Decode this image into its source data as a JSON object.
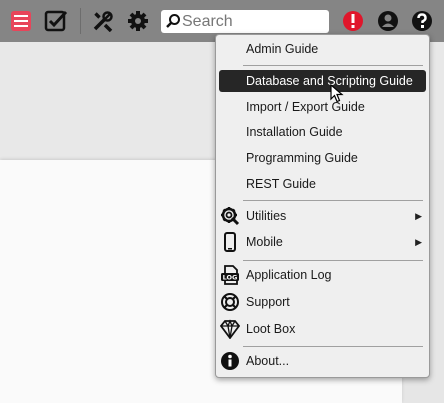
{
  "search": {
    "placeholder": "Search",
    "value": ""
  },
  "menu": {
    "items": [
      {
        "label": "Admin Guide"
      },
      {
        "label": "Database and Scripting Guide"
      },
      {
        "label": "Import / Export Guide"
      },
      {
        "label": "Installation Guide"
      },
      {
        "label": "Programming Guide"
      },
      {
        "label": "REST Guide"
      },
      {
        "label": "Utilities"
      },
      {
        "label": "Mobile"
      },
      {
        "label": "Application Log"
      },
      {
        "label": "Support"
      },
      {
        "label": "Loot Box"
      },
      {
        "label": "About..."
      }
    ]
  },
  "icons": {
    "toolbar": [
      "list-icon",
      "checklist-icon",
      "tools-icon",
      "gear-icon",
      "search-icon",
      "alert-icon",
      "user-icon",
      "help-icon"
    ],
    "menu": [
      "gear-search-icon",
      "mobile-icon",
      "log-icon",
      "lifebuoy-icon",
      "diamond-icon",
      "info-icon"
    ]
  },
  "colors": {
    "topbar": "#858585",
    "alert": "#e0162b",
    "list": "#e8455a",
    "active_item": "#262626"
  }
}
